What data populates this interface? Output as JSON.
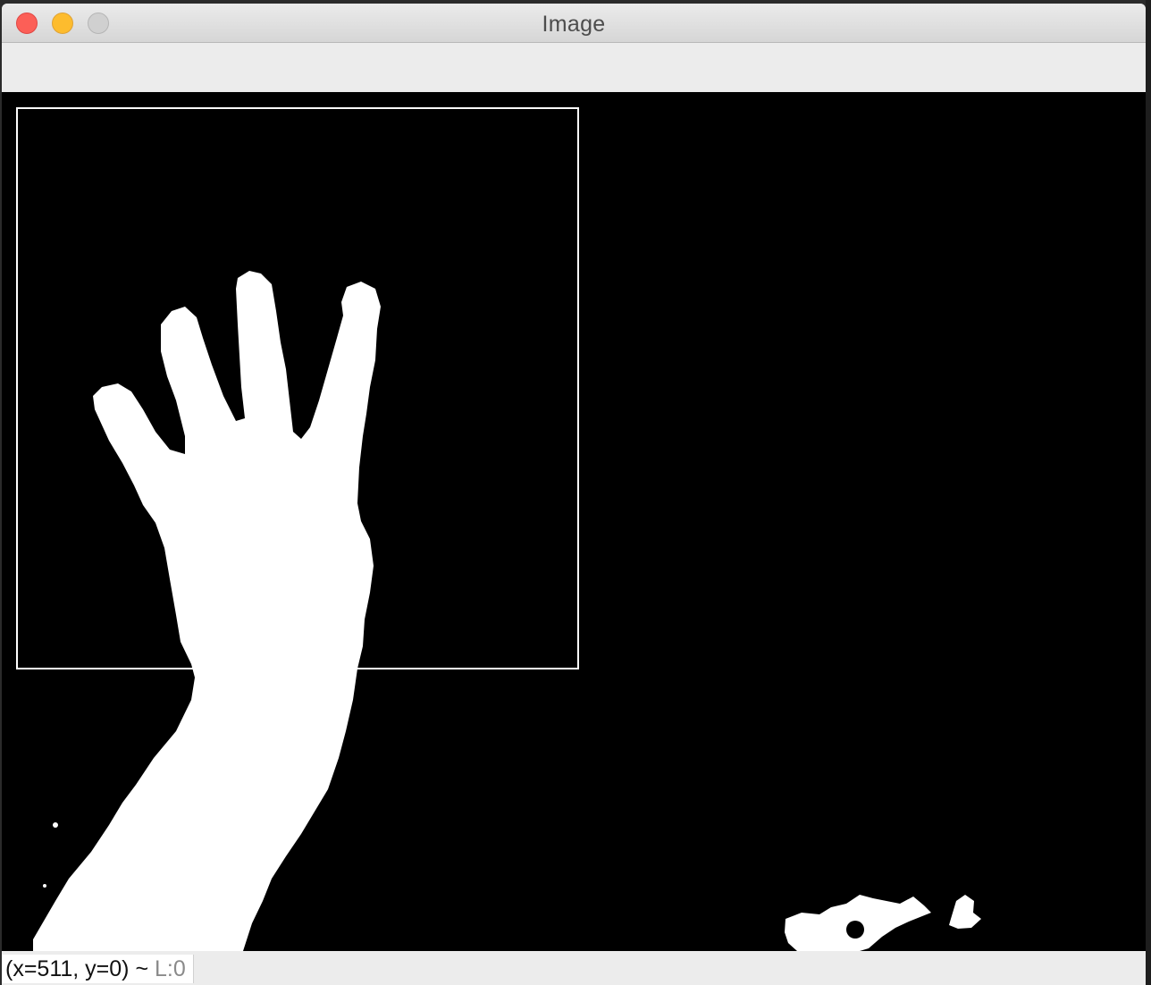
{
  "window": {
    "title": "Image"
  },
  "statusbar": {
    "coords": "(x=511, y=0) ~",
    "level": "L:0"
  }
}
